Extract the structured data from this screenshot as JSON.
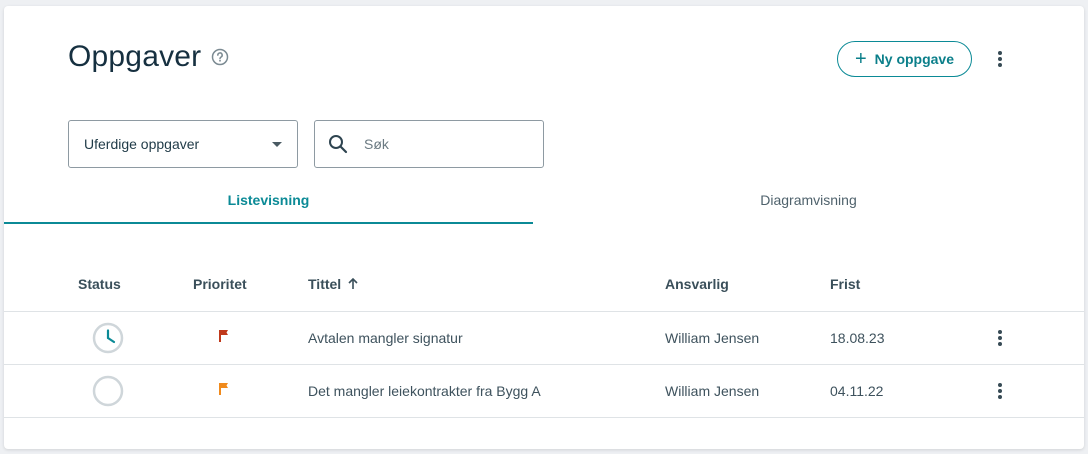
{
  "header": {
    "title": "Oppgaver",
    "new_button_label": "Ny oppgave"
  },
  "filters": {
    "selected_filter": "Uferdige oppgaver",
    "search_placeholder": "Søk"
  },
  "tabs": [
    {
      "label": "Listevisning",
      "active": true
    },
    {
      "label": "Diagramvisning",
      "active": false
    }
  ],
  "table": {
    "columns": {
      "status": "Status",
      "priority": "Prioritet",
      "title": "Tittel",
      "owner": "Ansvarlig",
      "deadline": "Frist"
    },
    "sort": {
      "column": "title",
      "direction": "ascending"
    },
    "rows": [
      {
        "status": "in-progress",
        "priority": "high",
        "title": "Avtalen mangler signatur",
        "owner": "William Jensen",
        "deadline": "18.08.23"
      },
      {
        "status": "not-started",
        "priority": "medium",
        "title": "Det mangler leiekontrakter fra Bygg A",
        "owner": "William Jensen",
        "deadline": "04.11.22"
      }
    ]
  },
  "colors": {
    "accent": "#0b8a96",
    "priority_high": "#c0391b",
    "priority_medium": "#f08a1c",
    "status_ring": "#cfd6da"
  },
  "icons": {
    "help": "help-circle-icon",
    "add": "plus-icon",
    "more": "more-vertical-icon",
    "dropdown": "caret-down-icon",
    "search": "search-icon",
    "sort": "arrow-up-icon",
    "status_in_progress": "clock-icon",
    "status_not_started": "empty-circle-icon",
    "priority": "flag-icon"
  }
}
